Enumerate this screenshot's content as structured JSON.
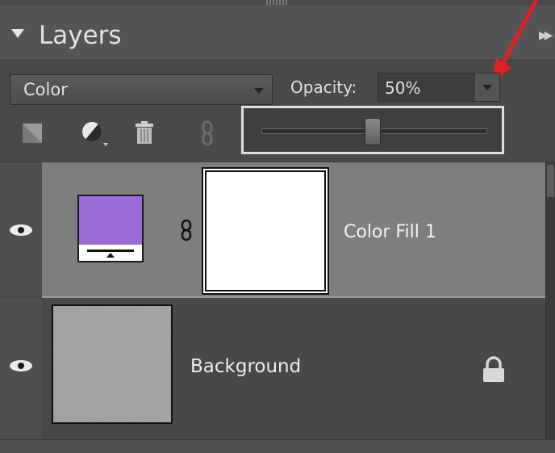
{
  "panel": {
    "title": "Layers"
  },
  "blend_mode": {
    "selected": "Color"
  },
  "opacity": {
    "label": "Opacity:",
    "value": "50%",
    "slider_fraction": 0.5
  },
  "toolbar": {
    "icons": [
      "new-layer-icon",
      "adjustment-layer-icon",
      "trash-icon",
      "link-icon"
    ]
  },
  "layers": [
    {
      "name": "Color Fill 1",
      "selected": true,
      "visible": true,
      "fill_color": "#9a6ad6",
      "has_mask": true
    },
    {
      "name": "Background",
      "selected": false,
      "visible": true,
      "locked": true
    }
  ],
  "colors": {
    "annotation_arrow": "#e02020",
    "selected_row": "#7e7e7e"
  }
}
